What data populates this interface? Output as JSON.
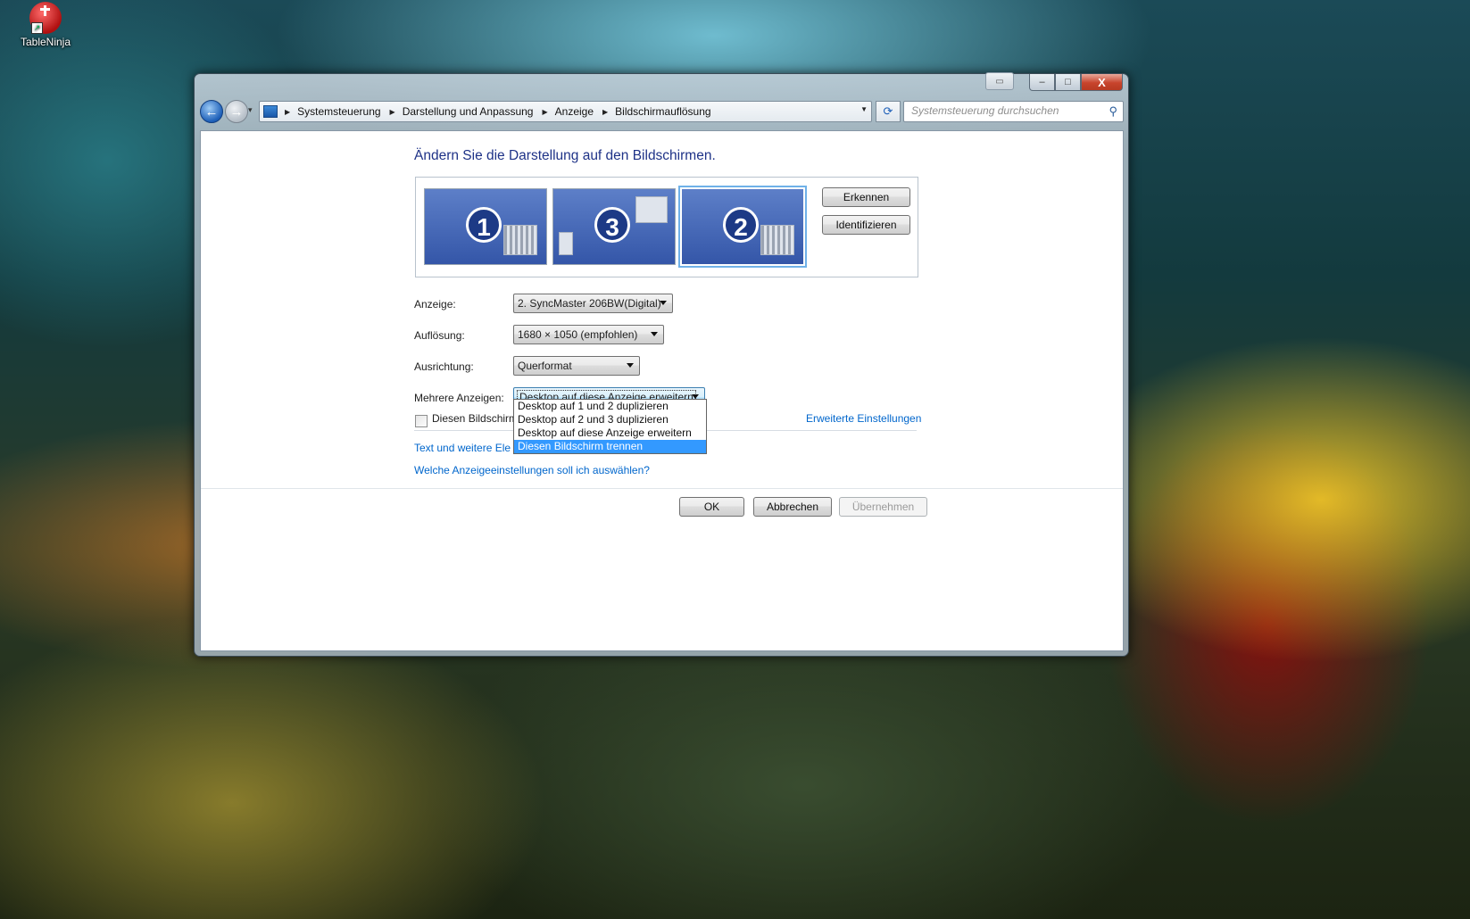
{
  "desktop": {
    "icons": [
      {
        "label": "TableNinja"
      }
    ]
  },
  "window": {
    "controls": {
      "minimize": "–",
      "maximize": "□",
      "close": "X"
    },
    "nav": {
      "back_glyph": "←",
      "forward_glyph": "→",
      "breadcrumbs": [
        "Systemsteuerung",
        "Darstellung und Anpassung",
        "Anzeige",
        "Bildschirmauflösung"
      ],
      "search_placeholder": "Systemsteuerung durchsuchen"
    }
  },
  "main": {
    "title": "Ändern Sie die Darstellung auf den Bildschirmen.",
    "monitors": [
      {
        "number": "1",
        "selected": false
      },
      {
        "number": "3",
        "selected": false
      },
      {
        "number": "2",
        "selected": true
      }
    ],
    "buttons": {
      "detect": "Erkennen",
      "identify": "Identifizieren"
    },
    "form": {
      "display_label": "Anzeige:",
      "display_value": "2. SyncMaster 206BW(Digital)",
      "resolution_label": "Auflösung:",
      "resolution_value": "1680 × 1050 (empfohlen)",
      "orientation_label": "Ausrichtung:",
      "orientation_value": "Querformat",
      "multi_label": "Mehrere Anzeigen:",
      "multi_value": "Desktop auf diese Anzeige erweitern",
      "multi_options": [
        "Desktop auf 1 und 2 duplizieren",
        "Desktop auf 2 und 3 duplizieren",
        "Desktop auf diese Anzeige erweitern",
        "Diesen Bildschirm trennen"
      ],
      "multi_highlighted": "Diesen Bildschirm trennen"
    },
    "primary_checkbox_label": "Diesen Bildschirm",
    "advanced_link": "Erweiterte Einstellungen",
    "text_size_link_visible": "Text und weitere Ele",
    "help_link": "Welche Anzeigeeinstellungen soll ich auswählen?",
    "actions": {
      "ok": "OK",
      "cancel": "Abbrechen",
      "apply": "Übernehmen"
    }
  },
  "colors": {
    "link": "#0066cc",
    "title": "#1e3287",
    "highlight": "#3399ff",
    "monitor": "#3456a8"
  }
}
